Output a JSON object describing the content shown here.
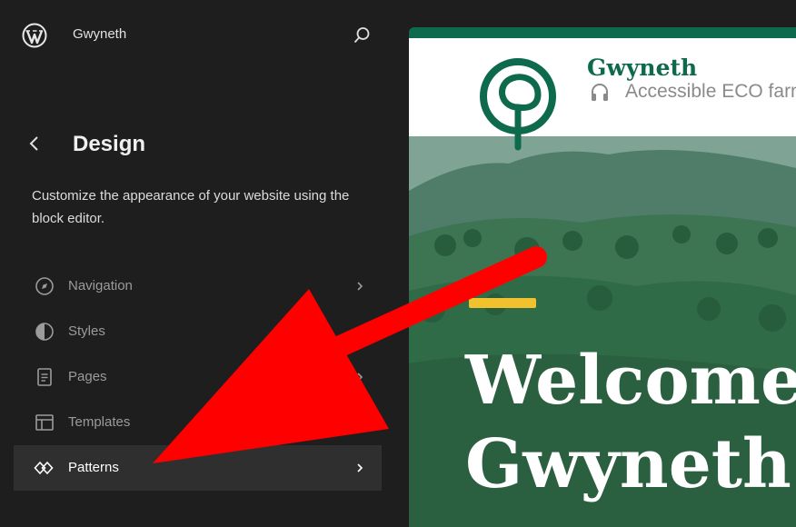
{
  "header": {
    "site_name": "Gwyneth"
  },
  "sidebar": {
    "title": "Design",
    "description": "Customize the appearance of your website using the block editor.",
    "items": [
      {
        "label": "Navigation",
        "icon": "compass-icon",
        "active": false
      },
      {
        "label": "Styles",
        "icon": "half-circle-icon",
        "active": false
      },
      {
        "label": "Pages",
        "icon": "page-icon",
        "active": false
      },
      {
        "label": "Templates",
        "icon": "layout-icon",
        "active": false
      },
      {
        "label": "Patterns",
        "icon": "diamond-pattern-icon",
        "active": true
      }
    ]
  },
  "preview": {
    "site_title": "Gwyneth",
    "tagline": "Accessible ECO farm",
    "hero_heading_line1": "Welcome",
    "hero_heading_line2": "Gwyneth"
  },
  "colors": {
    "sidebar_bg": "#1e1e1e",
    "brand_green": "#0e6a4c",
    "accent_yellow": "#f2c12e",
    "annotation_red": "#ff0000"
  }
}
